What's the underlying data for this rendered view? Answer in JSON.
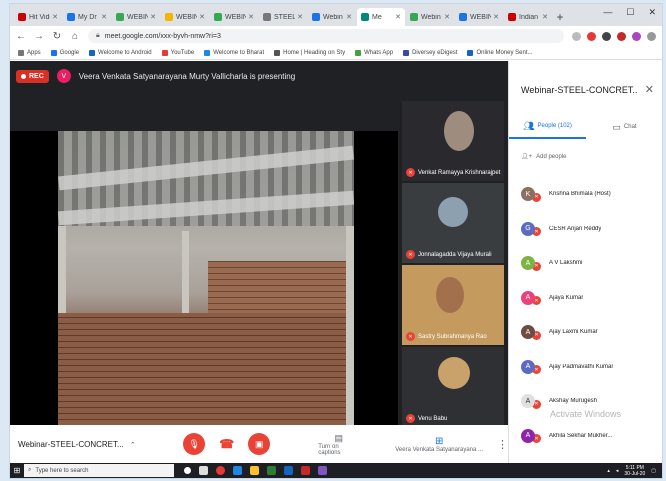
{
  "browser": {
    "tabs": [
      {
        "label": "Hit Video",
        "color": "#c00"
      },
      {
        "label": "My Dr",
        "color": "#1a73e8"
      },
      {
        "label": "WEBIN",
        "color": "#34a853"
      },
      {
        "label": "WEBIN",
        "color": "#f4b400"
      },
      {
        "label": "WEBIN",
        "color": "#34a853"
      },
      {
        "label": "STEEL",
        "color": "#777"
      },
      {
        "label": "Webin",
        "color": "#1a73e8"
      },
      {
        "label": "Me",
        "color": "#00897b",
        "active": true
      },
      {
        "label": "Webin",
        "color": "#34a853"
      },
      {
        "label": "WEBIN",
        "color": "#1a73e8"
      },
      {
        "label": "Indian",
        "color": "#c00"
      }
    ],
    "url": "meet.google.com/xxx-byvh-nmw?ri=3",
    "bookmarks": [
      "Apps",
      "Google",
      "Welcome to Android",
      "YouTube",
      "Welcome to Bharat",
      "Home | Heading on Sty",
      "Whats App",
      "Diversey eDigest",
      "Online Money Sent..."
    ]
  },
  "meet": {
    "rec_label": "REC",
    "presenter_initial": "V",
    "presenting_text": "Veera Venkata Satyanarayana Murty Vallicharla is presenting",
    "tiles": [
      {
        "name": "Venkat Ramayya Krishnarajpet",
        "bg": "#2a2a2e"
      },
      {
        "name": "Jonnalagadda Vijaya Murali",
        "bg": "#3a3d40"
      },
      {
        "name": "Sastry Subrahmanya Rao",
        "bg": "#c49a5e"
      },
      {
        "name": "Venu Babu",
        "bg": "#2f3033"
      }
    ],
    "meeting_title": "Webinar-STEEL-CONCRET...",
    "captions_label": "Turn on captions",
    "present_label": "Veera Venkata Satyanarayana ...",
    "more_icon": "⋮"
  },
  "panel": {
    "title": "Webinar-STEEL-CONCRET...",
    "people_tab": "People (102)",
    "chat_tab": "Chat",
    "add_people": "Add people",
    "people": [
      {
        "name": "Krishna Bhimala (Host)",
        "initial": "K",
        "color": "#8d6e63"
      },
      {
        "name": "CESR Anjan Reddy",
        "initial": "G",
        "color": "#5c6bc0"
      },
      {
        "name": "A V Lakshmi",
        "initial": "A",
        "color": "#7cb342"
      },
      {
        "name": "Ajaya Kumar",
        "initial": "A",
        "color": "#ec407a"
      },
      {
        "name": "Ajay Laxmi Kumar",
        "initial": "A",
        "color": "#6d4c41"
      },
      {
        "name": "Ajay Padmavathi Kumar",
        "initial": "A",
        "color": "#5c6bc0"
      },
      {
        "name": "Akshay Murugesh",
        "initial": "A",
        "color": "#e0e0e0"
      },
      {
        "name": "Akhila Sekhar Mukher...",
        "initial": "A",
        "color": "#8e24aa"
      }
    ],
    "activate_text": "Activate Windows"
  },
  "taskbar": {
    "search_placeholder": "Type here to search",
    "time": "5:11 PM",
    "date": "30-Jul-20"
  }
}
